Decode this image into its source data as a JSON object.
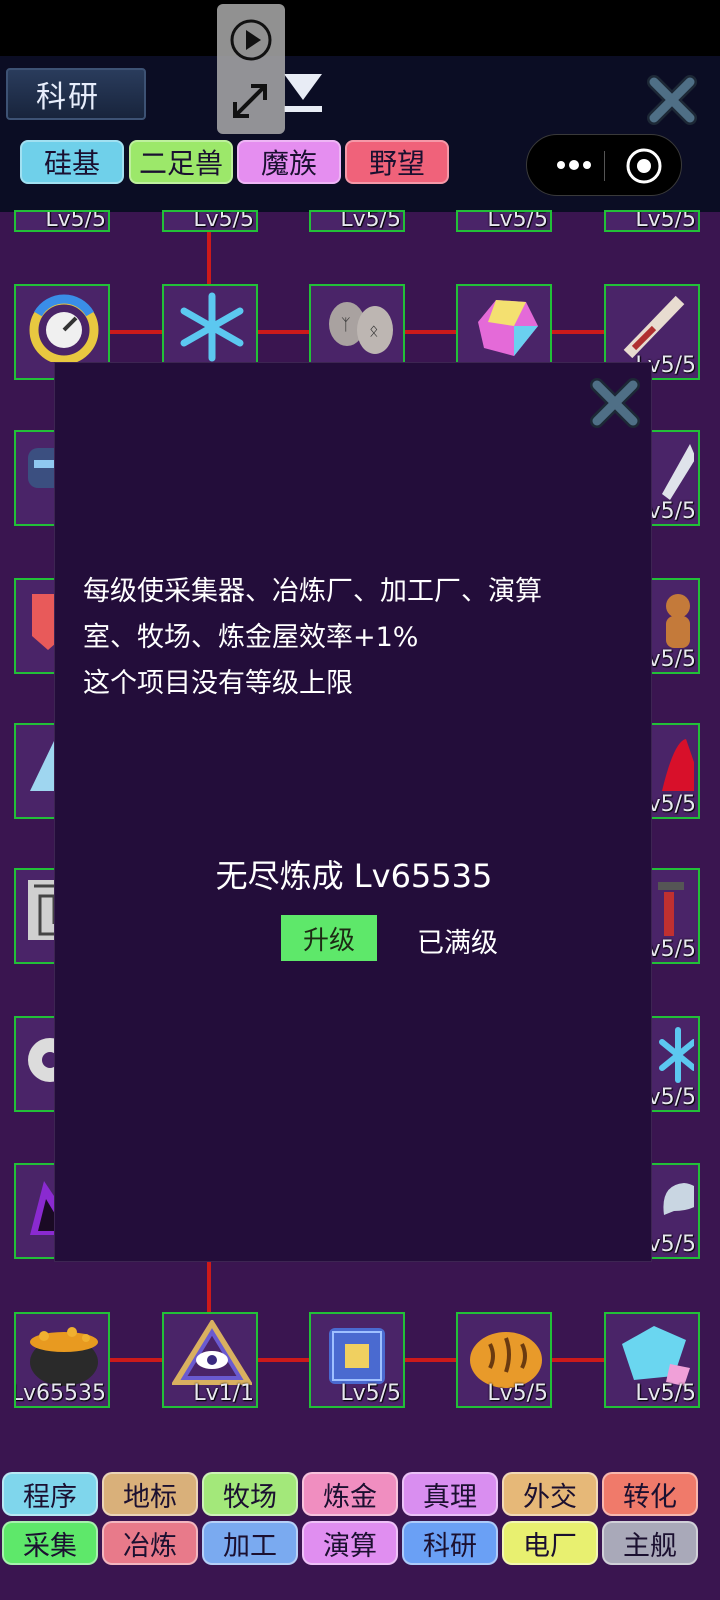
{
  "header": {
    "title": "科研",
    "faction_tabs": [
      {
        "label": "硅基",
        "color": "#6fd0ea"
      },
      {
        "label": "二足兽",
        "color": "#9ce86a"
      },
      {
        "label": "魔族",
        "color": "#e58ef0"
      },
      {
        "label": "野望",
        "color": "#f0627a"
      }
    ]
  },
  "grid": {
    "top_row_levels": [
      "Lv5/5",
      "Lv5/5",
      "Lv5/5",
      "Lv5/5",
      "Lv5/5"
    ],
    "row2_levels": [
      "",
      "",
      "",
      "",
      "Lv5/5"
    ],
    "right_col_levels": [
      "v5/5",
      "v5/5",
      "v5/5",
      "v5/5",
      "v5/5",
      "v5/5"
    ],
    "bottom_row": [
      {
        "level": "Lv65535",
        "icon": "cauldron-icon"
      },
      {
        "level": "Lv1/1",
        "icon": "eye-triangle-icon"
      },
      {
        "level": "Lv5/5",
        "icon": "chip-icon"
      },
      {
        "level": "Lv5/5",
        "icon": "bread-icon"
      },
      {
        "level": "Lv5/5",
        "icon": "crystal-icon"
      }
    ]
  },
  "modal": {
    "description": "每级使采集器、冶炼厂、加工厂、演算\n室、牧场、炼金屋效率+1%\n这个项目没有等级上限",
    "item_name": "无尽炼成 Lv65535",
    "upgrade_label": "升级",
    "max_label": "已满级"
  },
  "bottom_nav": {
    "row1": [
      {
        "label": "程序",
        "color": "#7fd6ec"
      },
      {
        "label": "地标",
        "color": "#d9b07a"
      },
      {
        "label": "牧场",
        "color": "#a3e87a"
      },
      {
        "label": "炼金",
        "color": "#f08ec0"
      },
      {
        "label": "真理",
        "color": "#d98ef0"
      },
      {
        "label": "外交",
        "color": "#e6b878"
      },
      {
        "label": "转化",
        "color": "#f07a6a"
      }
    ],
    "row2": [
      {
        "label": "采集",
        "color": "#5ee86a"
      },
      {
        "label": "冶炼",
        "color": "#e87a8a"
      },
      {
        "label": "加工",
        "color": "#7aaaf0"
      },
      {
        "label": "演算",
        "color": "#e08ef0"
      },
      {
        "label": "科研",
        "color": "#6aa0f5"
      },
      {
        "label": "电厂",
        "color": "#e8f070"
      },
      {
        "label": "主舰",
        "color": "#a9a9b9"
      }
    ]
  }
}
